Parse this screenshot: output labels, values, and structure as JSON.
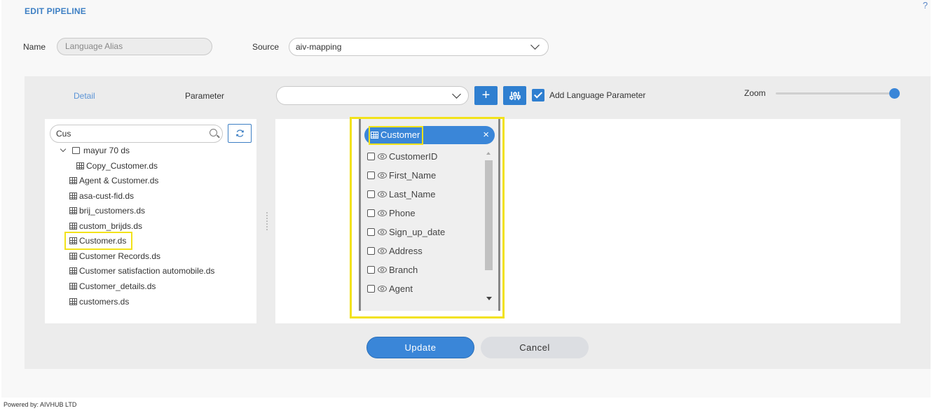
{
  "page": {
    "title": "EDIT PIPELINE",
    "help": "?",
    "name_label": "Name",
    "name_value": "Language Alias",
    "source_label": "Source",
    "source_value": "aiv-mapping"
  },
  "panel": {
    "tabs": [
      {
        "label": "Detail"
      },
      {
        "label": "Parameter"
      }
    ],
    "parameter_value": "",
    "add_button_label": "+",
    "add_language_parameter_label": "Add Language Parameter",
    "add_language_parameter_checked": true,
    "zoom_label": "Zoom",
    "zoom_level": 1.0
  },
  "tree": {
    "search_value": "Cus",
    "items": [
      {
        "label": "mayur 70 ds",
        "type": "folder"
      },
      {
        "label": "Copy_Customer.ds",
        "type": "dataset"
      },
      {
        "label": "Agent & Customer.ds",
        "type": "dataset"
      },
      {
        "label": "asa-cust-fid.ds",
        "type": "dataset"
      },
      {
        "label": "brij_customers.ds",
        "type": "dataset"
      },
      {
        "label": "custom_brijds.ds",
        "type": "dataset"
      },
      {
        "label": "Customer.ds",
        "type": "dataset",
        "highlighted": true
      },
      {
        "label": "Customer Records.ds",
        "type": "dataset"
      },
      {
        "label": "Customer satisfaction automobile.ds",
        "type": "dataset"
      },
      {
        "label": "Customer_details.ds",
        "type": "dataset"
      },
      {
        "label": "customers.ds",
        "type": "dataset"
      }
    ]
  },
  "node": {
    "title": "Customer",
    "close": "×",
    "fields": [
      {
        "label": "CustomerID"
      },
      {
        "label": "First_Name"
      },
      {
        "label": "Last_Name"
      },
      {
        "label": "Phone"
      },
      {
        "label": "Sign_up_date"
      },
      {
        "label": "Address"
      },
      {
        "label": "Branch"
      },
      {
        "label": "Agent"
      }
    ]
  },
  "actions": {
    "update_label": "Update",
    "cancel_label": "Cancel"
  },
  "footer": {
    "text": "Powered by: AIVHUB LTD"
  },
  "colors": {
    "accent": "#3a86d8",
    "highlight": "#f2e21a"
  }
}
